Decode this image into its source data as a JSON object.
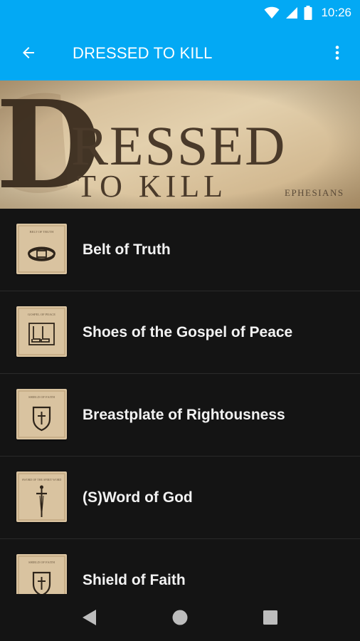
{
  "status_bar": {
    "time": "10:26",
    "icons": [
      "wifi-icon",
      "signal-icon",
      "battery-icon"
    ]
  },
  "app_bar": {
    "title": "DRESSED TO KILL",
    "back_icon": "back-arrow-icon",
    "menu_icon": "overflow-menu-icon"
  },
  "banner": {
    "title_initial": "D",
    "title_rest": "RESSED",
    "subtitle": "TO KILL",
    "reference": "EPHESIANS"
  },
  "items": [
    {
      "label": "Belt of Truth",
      "thumb_caption": "BELT OF TRUTH",
      "thumb_icon": "belt-icon"
    },
    {
      "label": "Shoes of the Gospel of Peace",
      "thumb_caption": "GOSPEL OF PEACE",
      "thumb_icon": "boots-icon"
    },
    {
      "label": "Breastplate of Rightousness",
      "thumb_caption": "SHIELD OF FAITH",
      "thumb_icon": "shield-cross-icon"
    },
    {
      "label": "(S)Word of God",
      "thumb_caption": "SWORD OF THE SPIRIT WORD",
      "thumb_icon": "sword-icon"
    },
    {
      "label": "Shield of Faith",
      "thumb_caption": "SHIELD OF FAITH",
      "thumb_icon": "shield-cross-icon"
    }
  ],
  "nav_bar": {
    "icons": [
      "nav-back-icon",
      "nav-home-icon",
      "nav-recents-icon"
    ]
  },
  "colors": {
    "primary": "#03a9f4",
    "background": "#141414",
    "text": "#f2f2f2",
    "parchment": "#d9c3a0"
  }
}
